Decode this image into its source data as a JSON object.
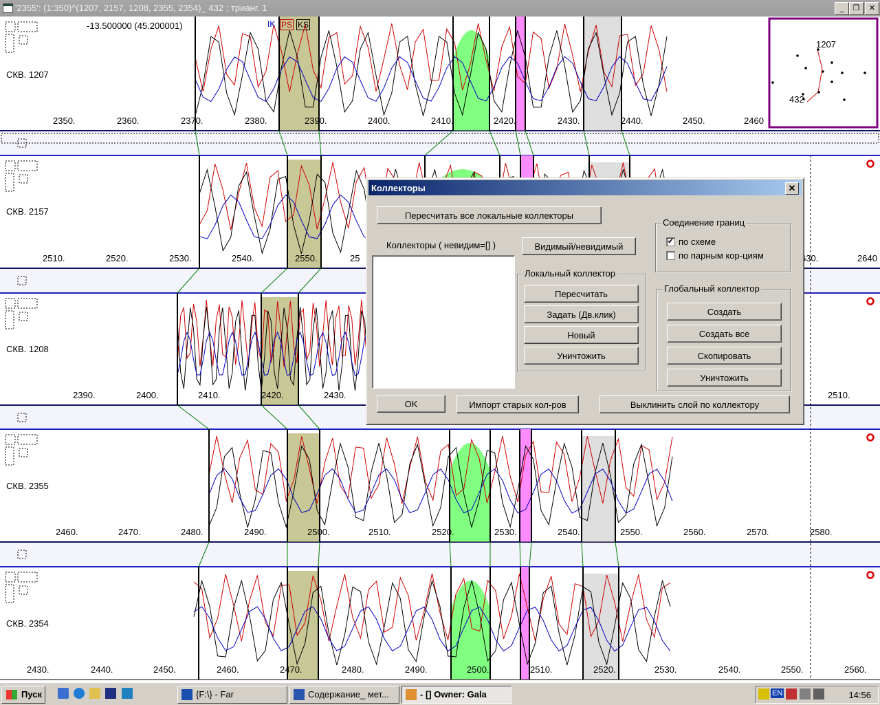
{
  "window": {
    "title": "'2355': (1:350)^(1207, 2157, 1208, 2355, 2354)_ 432 ; трианг. 1"
  },
  "header": {
    "coord": "-13.500000 (45.200001)",
    "legend": [
      "IK",
      "PS",
      "KS"
    ]
  },
  "wells": [
    {
      "name": "СКВ. 1207",
      "ticks": [
        "2350.",
        "2360.",
        "2370.",
        "2380.",
        "2390.",
        "2400.",
        "2410.",
        "2420.",
        "2430.",
        "2440.",
        "2450.",
        "2460"
      ]
    },
    {
      "name": "СКВ. 2157",
      "ticks": [
        "2510.",
        "2520.",
        "2530.",
        "2540.",
        "2550.",
        "25",
        "630.",
        "2640"
      ]
    },
    {
      "name": "СКВ. 1208",
      "ticks": [
        "2390.",
        "2400.",
        "2410.",
        "2420.",
        "2430.",
        "2510."
      ]
    },
    {
      "name": "СКВ. 2355",
      "ticks": [
        "2460.",
        "2470.",
        "2480.",
        "2490.",
        "2500.",
        "2510.",
        "2520.",
        "2530.",
        "2540.",
        "2550.",
        "2560.",
        "2570.",
        "2580."
      ]
    },
    {
      "name": "СКВ. 2354",
      "ticks": [
        "2430.",
        "2440.",
        "2450.",
        "2460.",
        "2470.",
        "2480.",
        "2490.",
        "2500.",
        "2510.",
        "2520.",
        "2530.",
        "2540.",
        "2550.",
        "2560."
      ]
    }
  ],
  "minimap": {
    "labels": [
      "1207",
      "432"
    ]
  },
  "dialog": {
    "title": "Коллекторы",
    "recalc_all": "Пересчитать все локальные коллекторы",
    "list_label": "Коллекторы ( невидим=[] )",
    "visible_btn": "Видимый/невидимый",
    "local": {
      "caption": "Локальный коллектор",
      "recalc": "Пересчитать",
      "set": "Задать (Дв.клик)",
      "new": "Новый",
      "destroy": "Уничтожить"
    },
    "join": {
      "caption": "Соединение границ",
      "opt1": "по схеме",
      "opt2": "по парным кор-циям",
      "opt1_checked": "✔"
    },
    "global": {
      "caption": "Глобальный коллектор",
      "create": "Создать",
      "create_all": "Создать все",
      "copy": "Скопировать",
      "destroy": "Уничтожить"
    },
    "ok": "OK",
    "import": "Импорт старых кол-ров",
    "align": "Выклинить слой по коллектору"
  },
  "taskbar": {
    "start": "Пуск",
    "tasks": [
      "{F:\\} - Far",
      "Содержание_ мет...",
      "- [] Owner: Gala"
    ],
    "tray": {
      "lang": "EN",
      "clock": "14:56"
    }
  },
  "colors": {
    "olive": "#c8c896",
    "green": "#80ff80",
    "pink": "#ff8cff",
    "gray": "#dedede",
    "navy": "#0000a0"
  }
}
